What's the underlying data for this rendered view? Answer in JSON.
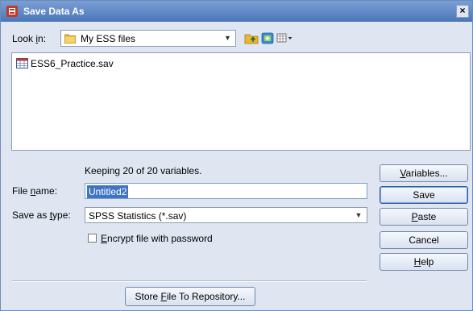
{
  "window": {
    "title": "Save Data As",
    "close_label": "×"
  },
  "lookin": {
    "label_pre": "Look ",
    "label_acc": "i",
    "label_post": "n:",
    "value": "My ESS files"
  },
  "files": [
    {
      "name": "ESS6_Practice.sav"
    }
  ],
  "keeping_text": "Keeping 20 of 20 variables.",
  "filename": {
    "label_pre": "File ",
    "label_acc": "n",
    "label_post": "ame:",
    "value": "Untitled2"
  },
  "savetype": {
    "label_pre": "Save as ",
    "label_acc": "t",
    "label_post": "ype:",
    "value": "SPSS Statistics (*.sav)"
  },
  "encrypt": {
    "label_acc": "E",
    "label_post": "ncrypt file with password",
    "checked": false
  },
  "buttons": {
    "variables": {
      "acc": "V",
      "rest": "ariables..."
    },
    "save": {
      "label": "Save"
    },
    "paste": {
      "acc": "P",
      "rest": "aste"
    },
    "cancel": {
      "label": "Cancel"
    },
    "help": {
      "acc": "H",
      "rest": "elp"
    }
  },
  "repository": {
    "pre": "Store ",
    "acc": "F",
    "post": "ile To Repository..."
  },
  "colors": {
    "titlebar": "#4b76b8",
    "selection": "#3f73c4",
    "dialog_bg": "#dfe6f2"
  },
  "icons": {
    "app": "spss-app-icon",
    "folder": "folder-icon",
    "up": "up-folder-icon",
    "newfolder": "new-folder-icon",
    "view": "view-menu-icon",
    "file": "sav-file-icon"
  }
}
